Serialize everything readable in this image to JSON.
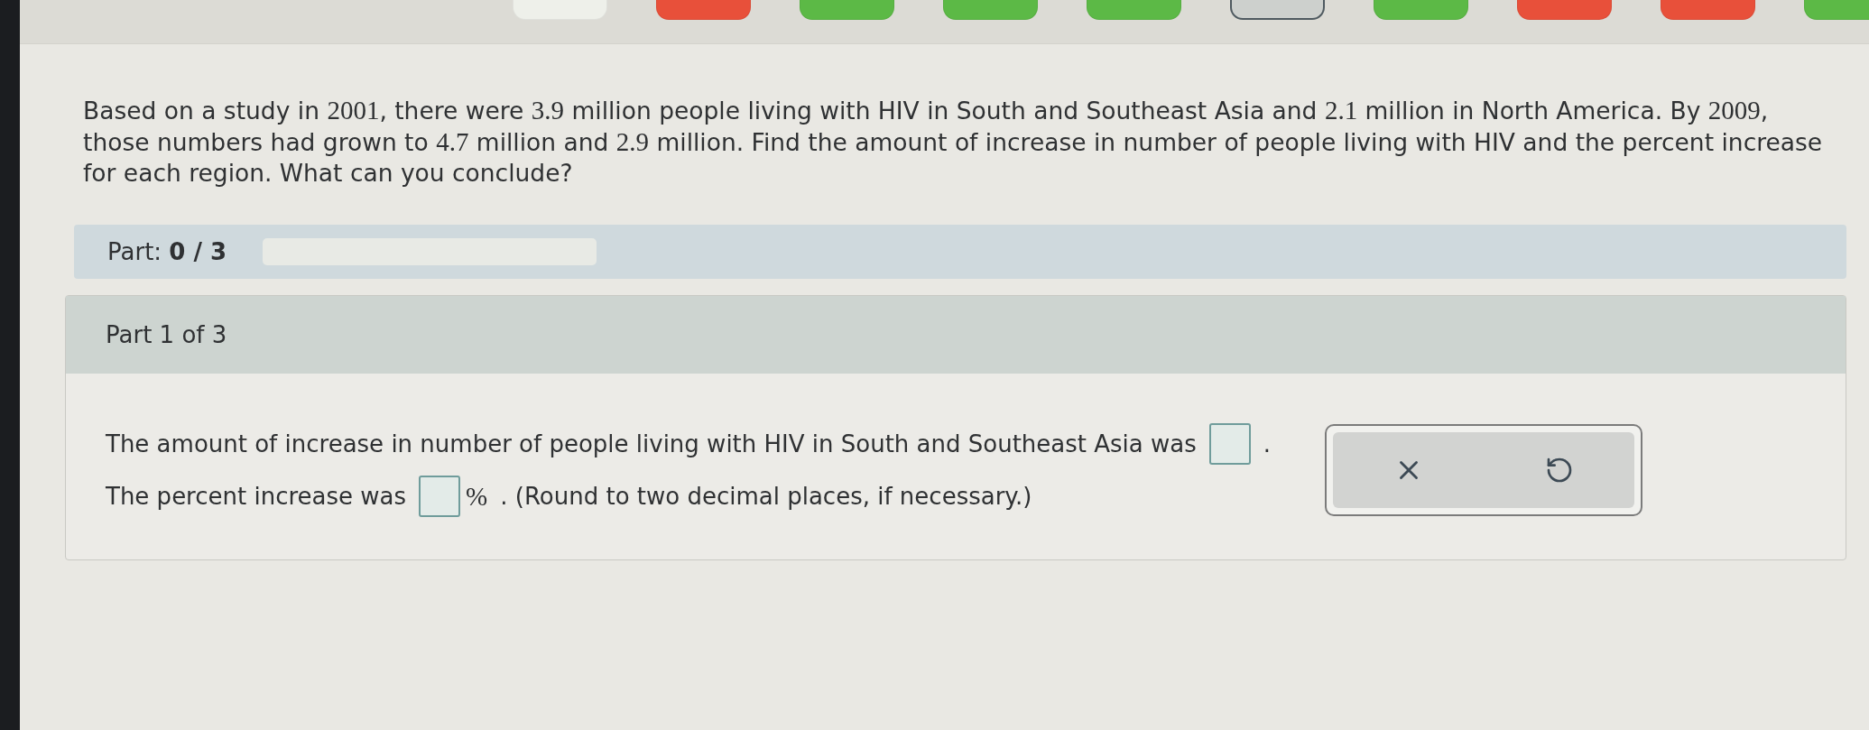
{
  "nav_buttons": [
    {
      "color": "#eef0ea",
      "selected": false
    },
    {
      "color": "#e8503a",
      "selected": false
    },
    {
      "color": "#5cb946",
      "selected": false
    },
    {
      "color": "#5cb946",
      "selected": false
    },
    {
      "color": "#5cb946",
      "selected": false
    },
    {
      "color": "#cdd0cd",
      "selected": true
    },
    {
      "color": "#5cb946",
      "selected": false
    },
    {
      "color": "#e8503a",
      "selected": false
    },
    {
      "color": "#e8503a",
      "selected": false
    },
    {
      "color": "#5cb946",
      "selected": false
    }
  ],
  "question": {
    "segments": [
      {
        "kind": "text",
        "text": "Based on a study in "
      },
      {
        "kind": "math",
        "text": "2001"
      },
      {
        "kind": "text",
        "text": ", there were "
      },
      {
        "kind": "math",
        "text": "3.9"
      },
      {
        "kind": "text",
        "text": " million people living with HIV in South and Southeast Asia and "
      },
      {
        "kind": "math",
        "text": "2.1"
      },
      {
        "kind": "text",
        "text": " million in North America. By "
      },
      {
        "kind": "math",
        "text": "2009"
      },
      {
        "kind": "text",
        "text": ", those numbers had grown to "
      },
      {
        "kind": "math",
        "text": "4.7"
      },
      {
        "kind": "text",
        "text": " million and "
      },
      {
        "kind": "math",
        "text": "2.9"
      },
      {
        "kind": "text",
        "text": " million. Find the amount of increase in number of people living with HIV and the percent increase for each region. What can you conclude?"
      }
    ]
  },
  "progress": {
    "label": "Part: **0 / 3**",
    "level": 0
  },
  "part": {
    "title": "Part 1 of 3",
    "lines": [
      [
        {
          "kind": "text",
          "text": "The amount of increase in number of people living with HIV in South and Southeast Asia was"
        },
        {
          "kind": "answer_box"
        },
        {
          "kind": "text",
          "text": "."
        }
      ],
      [
        {
          "kind": "text",
          "text": "The percent increase was"
        },
        {
          "kind": "answer_box"
        },
        {
          "kind": "math",
          "text": "%"
        },
        {
          "kind": "text",
          "text": ". (Round to two decimal places, if necessary.)"
        }
      ]
    ]
  }
}
